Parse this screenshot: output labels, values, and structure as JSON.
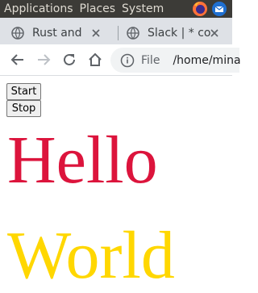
{
  "panel": {
    "menus": [
      "Applications",
      "Places",
      "System"
    ],
    "tray_icons": [
      "firefox-icon",
      "thunderbird-icon"
    ]
  },
  "tabs": [
    {
      "title": "Rust and C",
      "icon": "globe-icon"
    },
    {
      "title": "Slack | * co",
      "icon": "globe-icon"
    }
  ],
  "toolbar": {
    "back_icon": "back-arrow-icon",
    "forward_icon": "forward-arrow-icon",
    "reload_icon": "reload-icon",
    "home_icon": "home-icon"
  },
  "omnibox": {
    "scheme_label": "File",
    "url": "/home/mina"
  },
  "page": {
    "start_label": "Start",
    "stop_label": "Stop",
    "hello_text": "Hello",
    "hello_color": "#dc143c",
    "world_text": "World",
    "world_color": "#ffd700"
  }
}
